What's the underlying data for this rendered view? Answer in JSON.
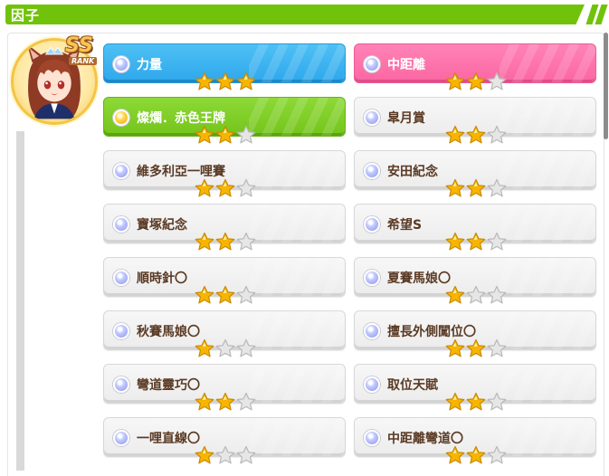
{
  "header": {
    "title": "因子"
  },
  "character": {
    "rank": "SS",
    "rank_label": "RANK"
  },
  "colors": {
    "header": "#71c20a",
    "blue_card": "#2ea7ec",
    "pink_card": "#fb66a2",
    "green_card": "#74c41a",
    "label_brown": "#5a3a24",
    "star_gold": "#f7b500",
    "star_empty": "#e6e6e6"
  },
  "factors": [
    {
      "label": "力量",
      "stars": 3,
      "type": "blue",
      "icon": "blue-orb-icon"
    },
    {
      "label": "中距離",
      "stars": 2,
      "type": "pink",
      "icon": "blue-orb-icon"
    },
    {
      "label": "燦爛．赤色王牌",
      "stars": 2,
      "type": "green",
      "icon": "gold-orb-icon"
    },
    {
      "label": "皐月賞",
      "stars": 2,
      "type": "white",
      "icon": "blue-orb-icon"
    },
    {
      "label": "維多利亞一哩賽",
      "stars": 2,
      "type": "white",
      "icon": "blue-orb-icon"
    },
    {
      "label": "安田紀念",
      "stars": 2,
      "type": "white",
      "icon": "blue-orb-icon"
    },
    {
      "label": "寶塚紀念",
      "stars": 2,
      "type": "white",
      "icon": "blue-orb-icon"
    },
    {
      "label": "希望S",
      "stars": 2,
      "type": "white",
      "icon": "blue-orb-icon"
    },
    {
      "label": "順時針〇",
      "stars": 2,
      "type": "white",
      "icon": "blue-orb-icon"
    },
    {
      "label": "夏賽馬娘〇",
      "stars": 1,
      "type": "white",
      "icon": "blue-orb-icon"
    },
    {
      "label": "秋賽馬娘〇",
      "stars": 1,
      "type": "white",
      "icon": "blue-orb-icon"
    },
    {
      "label": "擅長外側闖位〇",
      "stars": 2,
      "type": "white",
      "icon": "blue-orb-icon"
    },
    {
      "label": "彎道靈巧〇",
      "stars": 2,
      "type": "white",
      "icon": "blue-orb-icon"
    },
    {
      "label": "取位天賦",
      "stars": 2,
      "type": "white",
      "icon": "blue-orb-icon"
    },
    {
      "label": "一哩直線〇",
      "stars": 1,
      "type": "white",
      "icon": "blue-orb-icon"
    },
    {
      "label": "中距離彎道〇",
      "stars": 2,
      "type": "white",
      "icon": "blue-orb-icon"
    }
  ]
}
